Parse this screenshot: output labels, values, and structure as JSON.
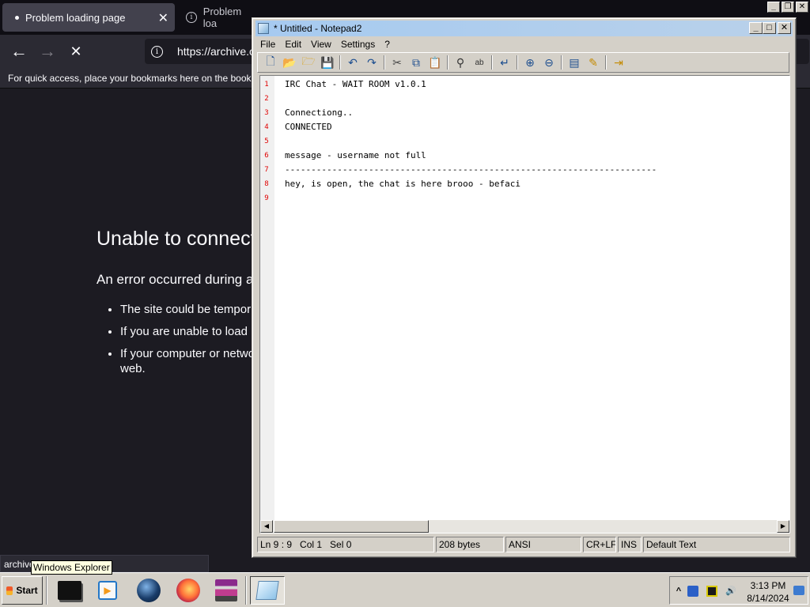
{
  "browser": {
    "tabs": [
      {
        "label": "Problem loading page"
      },
      {
        "label": "Problem loa"
      }
    ],
    "url_host": "https://archive.or",
    "bookmarks_hint": "For quick access, place your bookmarks here on the bookm",
    "error_title": "Unable to connect",
    "error_subtitle": "An error occurred during a",
    "error_items": [
      "The site could be tempor",
      "If you are unable to load",
      "If your computer or netwo web."
    ],
    "status_text": "archive",
    "tooltip": "Windows Explorer"
  },
  "notepad": {
    "title": "* Untitled - Notepad2",
    "menus": [
      "File",
      "Edit",
      "View",
      "Settings",
      "?"
    ],
    "lines": [
      {
        "n": "1",
        "text": "IRC Chat - WAIT ROOM v1.0.1"
      },
      {
        "n": "2",
        "text": ""
      },
      {
        "n": "3",
        "text": "Connectiong.."
      },
      {
        "n": "4",
        "text": "CONNECTED"
      },
      {
        "n": "5",
        "text": ""
      },
      {
        "n": "6",
        "text": "message - username not full"
      },
      {
        "n": "7",
        "text": "-----------------------------------------------------------------------"
      },
      {
        "n": "8",
        "text": "hey, is open, the chat is here brooo - befaci"
      },
      {
        "n": "9",
        "text": ""
      }
    ],
    "status": {
      "position": "Ln 9 : 9   Col 1   Sel 0",
      "size": "208 bytes",
      "encoding": "ANSI",
      "eol": "CR+LF",
      "mode": "INS",
      "scheme": "Default Text"
    }
  },
  "taskbar": {
    "start_label": "Start",
    "time": "3:13 PM",
    "date": "8/14/2024"
  }
}
